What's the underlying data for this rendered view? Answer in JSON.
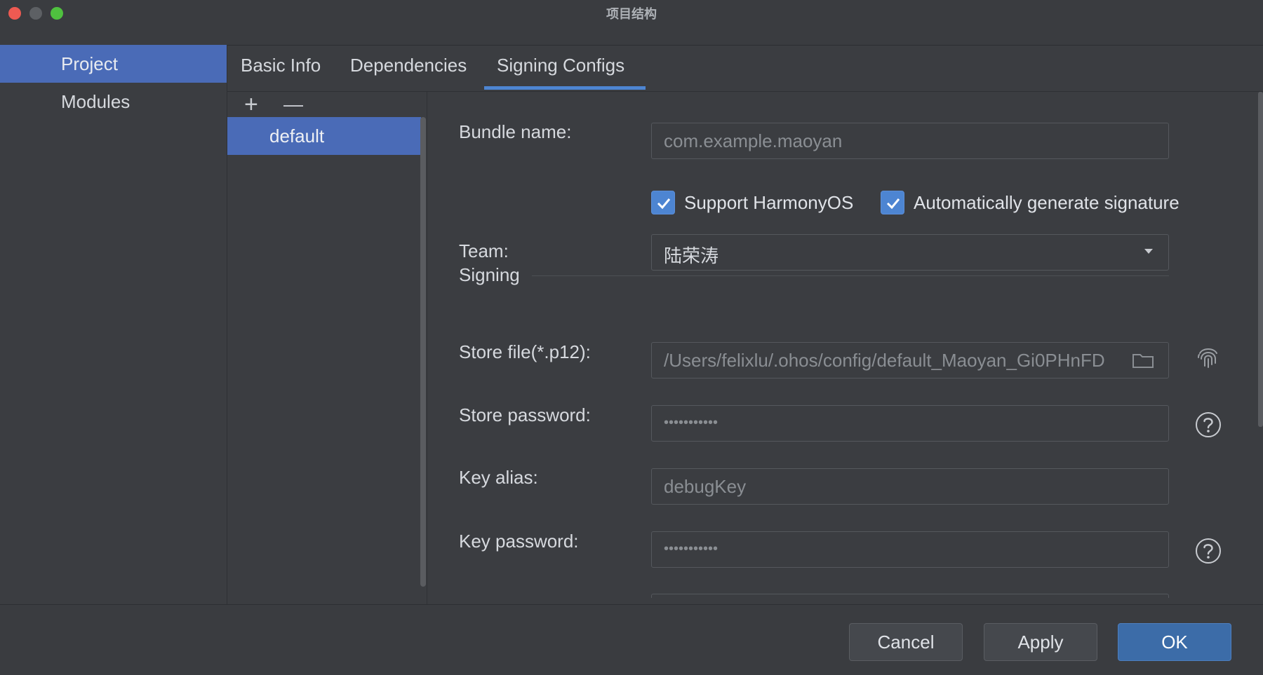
{
  "window": {
    "title": "项目结构"
  },
  "sidebar": {
    "items": [
      {
        "label": "Project",
        "active": true
      },
      {
        "label": "Modules",
        "active": false
      }
    ]
  },
  "tabs": [
    {
      "label": "Basic Info"
    },
    {
      "label": "Dependencies"
    },
    {
      "label": "Signing Configs",
      "active": true
    }
  ],
  "list": {
    "toolbar": {
      "add": "+",
      "remove": "—"
    },
    "items": [
      {
        "label": "default",
        "selected": true
      }
    ]
  },
  "form": {
    "bundle_name": {
      "label": "Bundle name:",
      "value": "com.example.maoyan"
    },
    "support_harmonyos": {
      "label": "Support HarmonyOS",
      "checked": true
    },
    "auto_signature": {
      "label": "Automatically generate signature",
      "checked": true
    },
    "team": {
      "label": "Team:",
      "value": "陆荣涛"
    },
    "signing_section": "Signing",
    "store_file": {
      "label": "Store file(*.p12):",
      "value": "/Users/felixlu/.ohos/config/default_Maoyan_Gi0PHnFD"
    },
    "store_password": {
      "label": "Store password:",
      "value": "•••••••••••"
    },
    "key_alias": {
      "label": "Key alias:",
      "value": "debugKey"
    },
    "key_password": {
      "label": "Key password:",
      "value": "•••••••••••"
    }
  },
  "footer": {
    "cancel": "Cancel",
    "apply": "Apply",
    "ok": "OK"
  },
  "icons": {
    "fingerprint": "fingerprint-icon",
    "help": "help-icon",
    "folder": "folder-icon"
  }
}
